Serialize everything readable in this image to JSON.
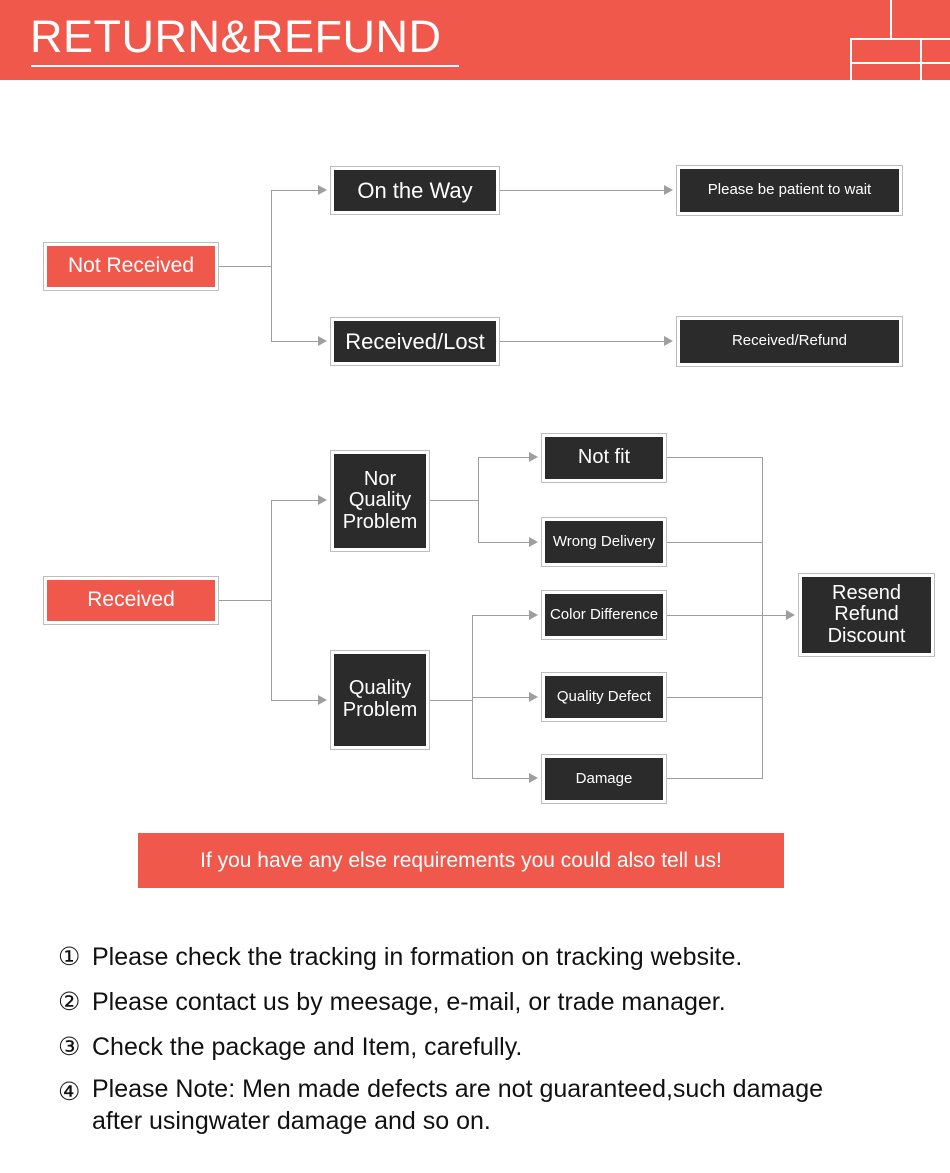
{
  "header": {
    "title": "RETURN&REFUND",
    "background_color": "#f0584c",
    "text_color": "#ffffff"
  },
  "colors": {
    "accent_red": "#f0584c",
    "dark_box": "#2b2b2b",
    "connector_gray": "#9e9e9e",
    "box_border": "#bdbdbd",
    "page_background": "#ffffff"
  },
  "flow_not_received": {
    "start": {
      "label": "Not Received",
      "style": "red"
    },
    "branches": [
      {
        "stage": {
          "label": "On the Way",
          "style": "dark"
        },
        "outcome": {
          "label": "Please be patient to wait",
          "style": "dark"
        }
      },
      {
        "stage": {
          "label": "Received/Lost",
          "style": "dark"
        },
        "outcome": {
          "label": "Received/Refund",
          "style": "dark"
        }
      }
    ]
  },
  "flow_received": {
    "start": {
      "label": "Received",
      "style": "red"
    },
    "categories": [
      {
        "label": "Nor\nQuality\nProblem",
        "reasons": [
          {
            "label": "Not fit"
          },
          {
            "label": "Wrong Delivery"
          }
        ]
      },
      {
        "label": "Quality\nProblem",
        "reasons": [
          {
            "label": "Color Difference"
          },
          {
            "label": "Quality Defect"
          },
          {
            "label": "Damage"
          }
        ]
      }
    ],
    "resolution": {
      "label": "Resend\nRefund\nDiscount",
      "style": "dark"
    }
  },
  "notice": {
    "text": "If you have any else requirements you could also tell us!"
  },
  "notes": [
    {
      "number": "①",
      "text": "Please check the tracking in formation on tracking website."
    },
    {
      "number": "②",
      "text": "Please contact us by meesage, e-mail, or trade manager."
    },
    {
      "number": "③",
      "text": "Check the package and Item, carefully."
    },
    {
      "number": "④",
      "text": "Please Note: Men made defects are not guaranteed,such damage\nafter usingwater damage and so on."
    }
  ]
}
